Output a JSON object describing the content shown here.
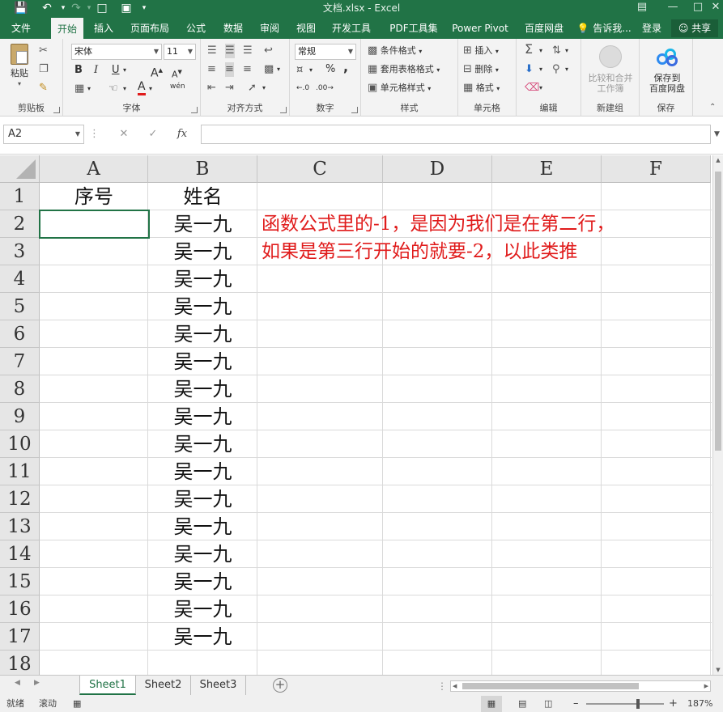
{
  "window": {
    "title": "文档.xlsx - Excel"
  },
  "menu": {
    "tabs": [
      "文件",
      "开始",
      "插入",
      "页面布局",
      "公式",
      "数据",
      "审阅",
      "视图",
      "开发工具",
      "PDF工具集",
      "Power Pivot",
      "百度网盘"
    ],
    "active": "开始",
    "tell_me": "告诉我...",
    "login": "登录",
    "share": "共享"
  },
  "ribbon": {
    "clipboard": {
      "label": "剪贴板",
      "paste": "粘贴"
    },
    "font": {
      "label": "字体",
      "name": "宋体",
      "size": "11",
      "bold": "B",
      "italic": "I",
      "underline": "U",
      "grow": "A",
      "shrink": "A",
      "color_a": "A",
      "wen": "wén"
    },
    "align": {
      "label": "对齐方式"
    },
    "number": {
      "label": "数字",
      "format": "常规",
      "percent": "%",
      "comma": ","
    },
    "styles": {
      "label": "样式",
      "conditional": "条件格式",
      "table": "套用表格格式",
      "cell": "单元格样式"
    },
    "cells": {
      "label": "单元格",
      "insert": "插入",
      "delete": "删除",
      "format": "格式"
    },
    "edit": {
      "label": "编辑"
    },
    "newgroup": {
      "label": "新建组",
      "btn_line1": "比较和合并",
      "btn_line2": "工作簿"
    },
    "save": {
      "label": "保存",
      "btn_line1": "保存到",
      "btn_line2": "百度网盘"
    }
  },
  "formula_bar": {
    "name_box": "A2",
    "cancel": "✕",
    "confirm": "✓",
    "fx": "fx",
    "value": ""
  },
  "grid": {
    "columns": [
      "A",
      "B",
      "C",
      "D",
      "E",
      "F"
    ],
    "rows": [
      "1",
      "2",
      "3",
      "4",
      "5",
      "6",
      "7",
      "8",
      "9",
      "10",
      "11",
      "12",
      "13",
      "14",
      "15",
      "16",
      "17",
      "18"
    ],
    "header": {
      "a1": "序号",
      "b1": "姓名"
    },
    "names": [
      "吴一九",
      "吴一九",
      "吴一九",
      "吴一九",
      "吴一九",
      "吴一九",
      "吴一九",
      "吴一九",
      "吴一九",
      "吴一九",
      "吴一九",
      "吴一九",
      "吴一九",
      "吴一九",
      "吴一九",
      "吴一九"
    ],
    "note_line1": "函数公式里的-1，是因为我们是在第二行，",
    "note_line2": "如果是第三行开始的就要-2，以此类推"
  },
  "sheets": [
    "Sheet1",
    "Sheet2",
    "Sheet3"
  ],
  "active_sheet": "Sheet1",
  "status": {
    "ready": "就绪",
    "scroll": "滚动",
    "zoom": "187%"
  },
  "colors": {
    "excel_green": "#217346",
    "note_red": "#e01b1b"
  }
}
